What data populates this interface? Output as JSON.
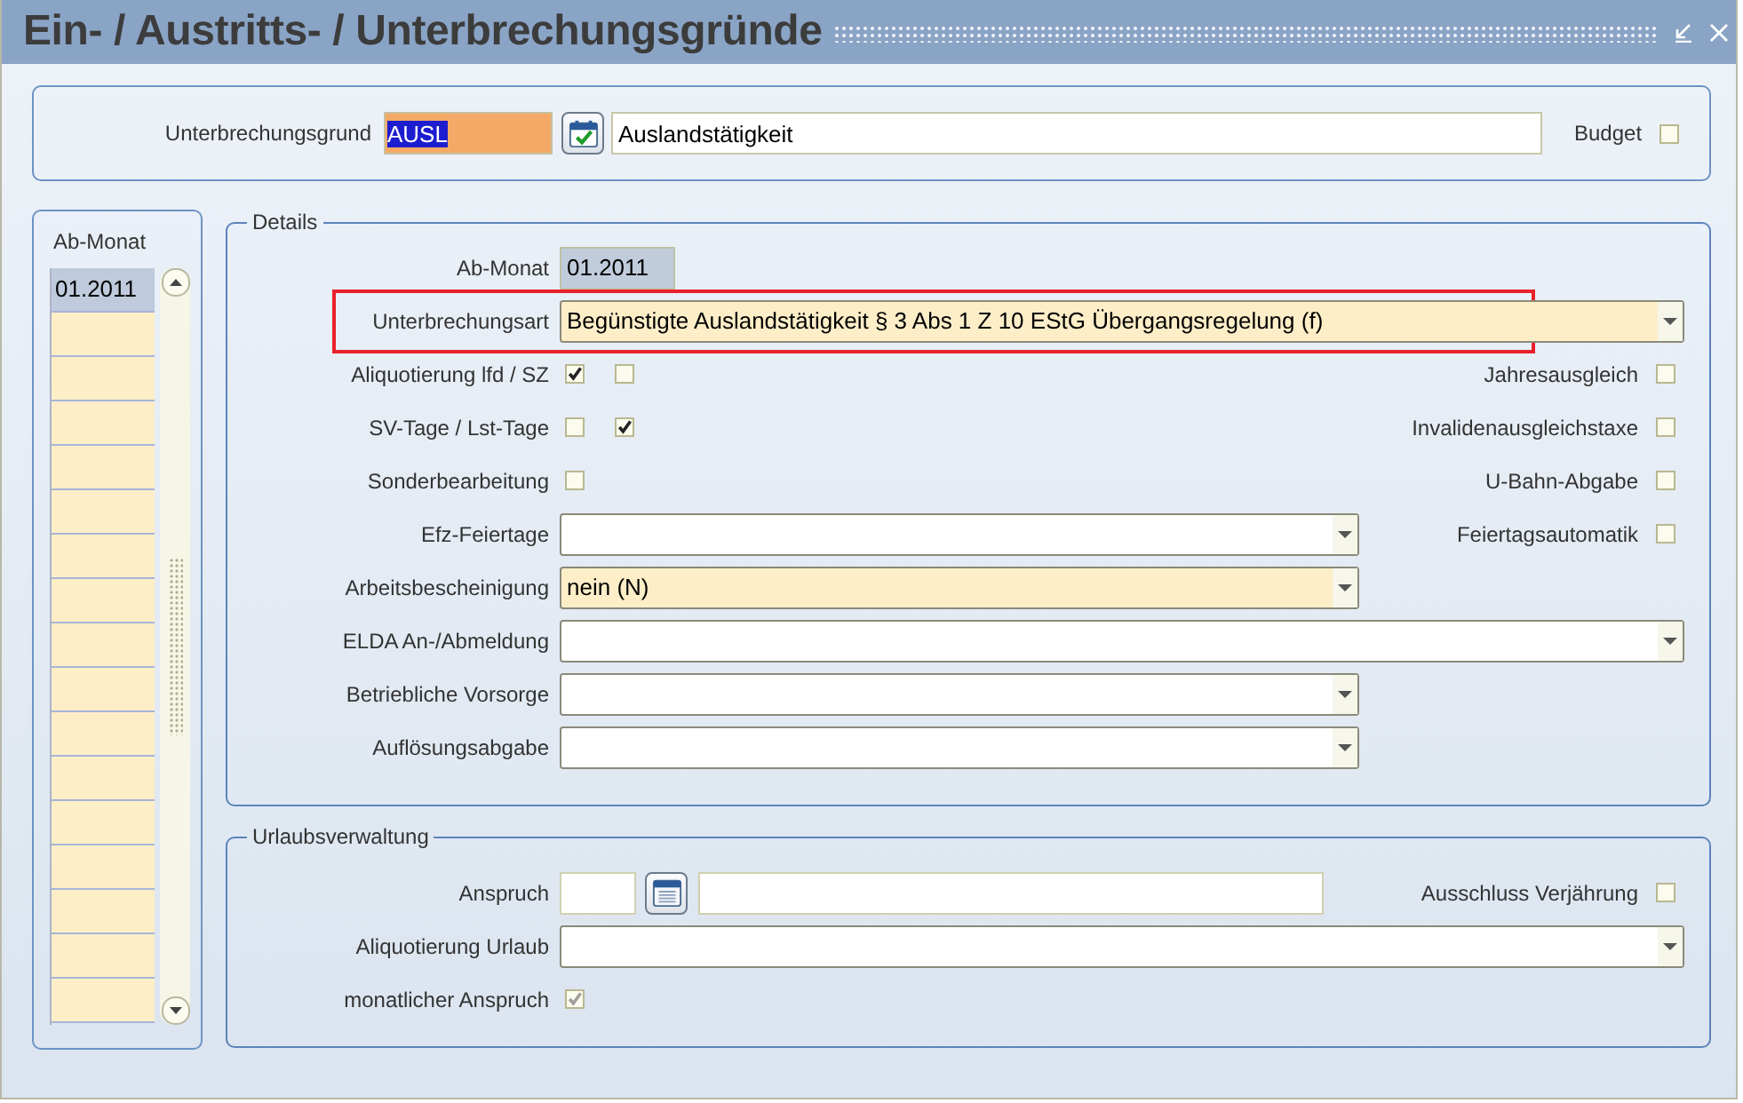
{
  "window": {
    "title": "Ein- / Austritts- / Unterbrechungsgründe"
  },
  "header": {
    "label": "Unterbrechungsgrund",
    "code": "AUSL",
    "code_text_selected": true,
    "description": "Auslandstätigkeit",
    "budget": {
      "label": "Budget",
      "checked": false
    }
  },
  "months": {
    "header": "Ab-Monat",
    "rows": [
      {
        "value": "01.2011",
        "selected": true
      }
    ]
  },
  "details": {
    "title": "Details",
    "rows": [
      {
        "kind": "readonly",
        "label": "Ab-Monat",
        "value": "01.2011"
      },
      {
        "kind": "dropdown",
        "label": "Unterbrechungsart",
        "value": "Begünstigte Auslandstätigkeit § 3 Abs 1 Z 10 EStG Übergangsregelung (f)",
        "required": true,
        "highlighted": true,
        "wide": true
      },
      {
        "kind": "checks",
        "label": "Aliquotierung lfd / SZ",
        "checks": [
          {
            "checked": true
          },
          {
            "checked": false
          }
        ],
        "aside": {
          "label": "Jahresausgleich",
          "checked": false
        }
      },
      {
        "kind": "checks",
        "label": "SV-Tage / Lst-Tage",
        "checks": [
          {
            "checked": false
          },
          {
            "checked": true
          }
        ],
        "aside": {
          "label": "Invalidenausgleichstaxe",
          "checked": false
        }
      },
      {
        "kind": "checks",
        "label": "Sonderbearbeitung",
        "checks": [
          {
            "checked": false
          }
        ],
        "aside": {
          "label": "U-Bahn-Abgabe",
          "checked": false
        }
      },
      {
        "kind": "dropdown",
        "label": "Efz-Feiertage",
        "required": false,
        "wide": false,
        "aside": {
          "label": "Feiertagsautomatik",
          "checked": false
        }
      },
      {
        "kind": "dropdown",
        "label": "Arbeitsbescheinigung",
        "value": "nein (N)",
        "required": true,
        "wide": false
      },
      {
        "kind": "dropdown",
        "label": "ELDA An-/Abmeldung",
        "required": false,
        "wide": true
      },
      {
        "kind": "dropdown",
        "label": "Betriebliche Vorsorge",
        "required": false,
        "wide": false
      },
      {
        "kind": "dropdown",
        "label": "Auflösungsabgabe",
        "required": false,
        "wide": false
      }
    ]
  },
  "vacation": {
    "title": "Urlaubsverwaltung",
    "rows": [
      {
        "kind": "amount",
        "label": "Anspruch",
        "aside": {
          "label": "Ausschluss Verjährung",
          "checked": false
        }
      },
      {
        "kind": "dropdown",
        "label": "Aliquotierung Urlaub",
        "required": false,
        "wide": true
      },
      {
        "kind": "checks",
        "label": "monatlicher Anspruch",
        "checks": [
          {
            "checked": true,
            "disabled": true
          }
        ]
      }
    ]
  }
}
